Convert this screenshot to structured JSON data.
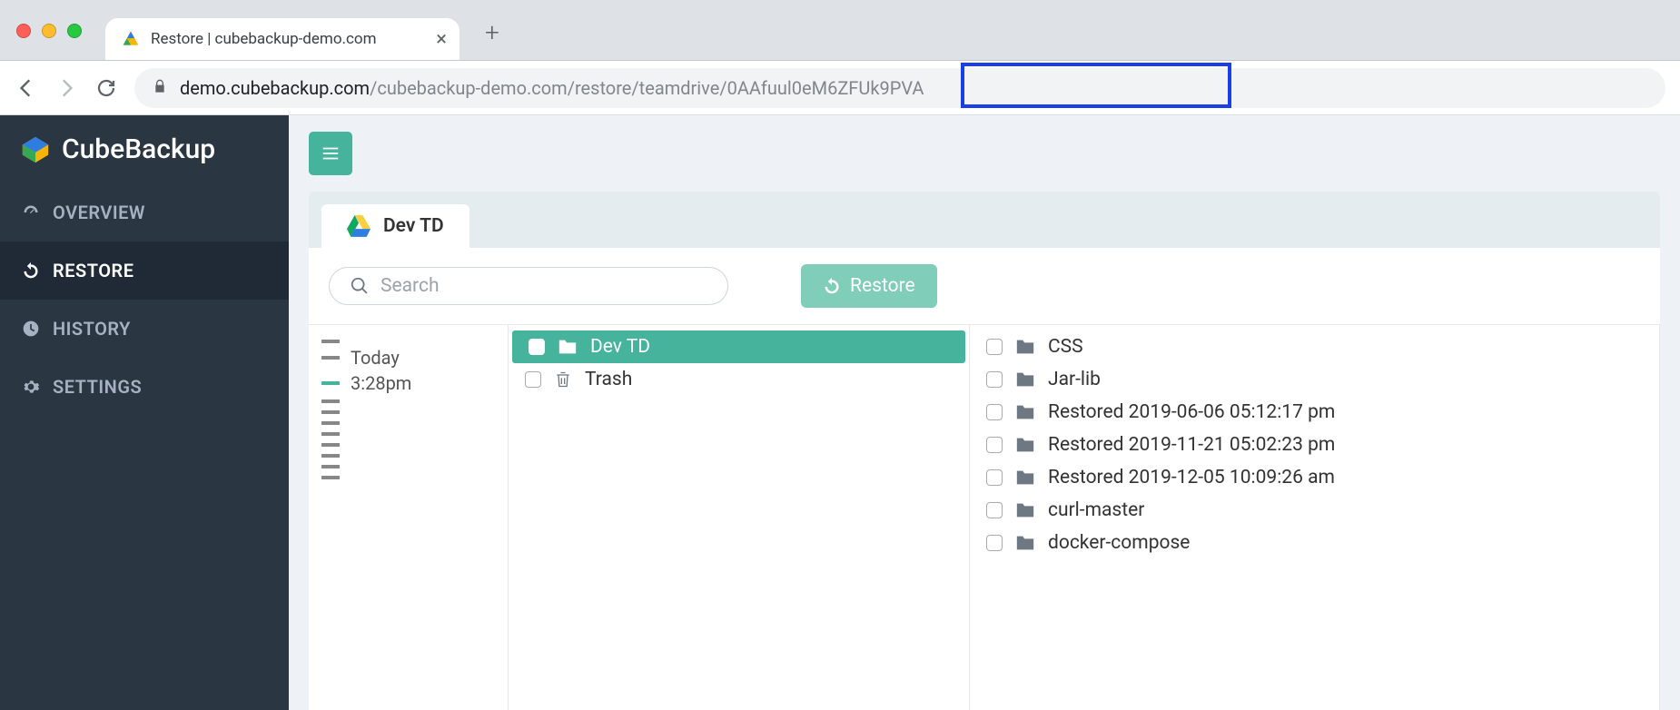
{
  "browser": {
    "tab_title": "Restore | cubebackup-demo.com",
    "url_host": "demo.cubebackup.com",
    "url_path": "/cubebackup-demo.com/restore/teamdrive/",
    "url_highlighted": "0AAfuul0eM6ZFUk9PVA"
  },
  "sidebar": {
    "brand": "CubeBackup",
    "items": [
      {
        "label": "OVERVIEW"
      },
      {
        "label": "RESTORE"
      },
      {
        "label": "HISTORY"
      },
      {
        "label": "SETTINGS"
      }
    ]
  },
  "tab": {
    "label": "Dev TD"
  },
  "search": {
    "placeholder": "Search"
  },
  "restore_button": "Restore",
  "timeline": {
    "day": "Today",
    "time": "3:28pm"
  },
  "mid_items": [
    {
      "label": "Dev TD",
      "icon": "folder",
      "selected": true
    },
    {
      "label": "Trash",
      "icon": "trash",
      "selected": false
    }
  ],
  "right_items": [
    {
      "label": "CSS"
    },
    {
      "label": "Jar-lib"
    },
    {
      "label": "Restored 2019-06-06 05:12:17 pm"
    },
    {
      "label": "Restored 2019-11-21 05:02:23 pm"
    },
    {
      "label": "Restored 2019-12-05 10:09:26 am"
    },
    {
      "label": "curl-master"
    },
    {
      "label": "docker-compose"
    }
  ]
}
